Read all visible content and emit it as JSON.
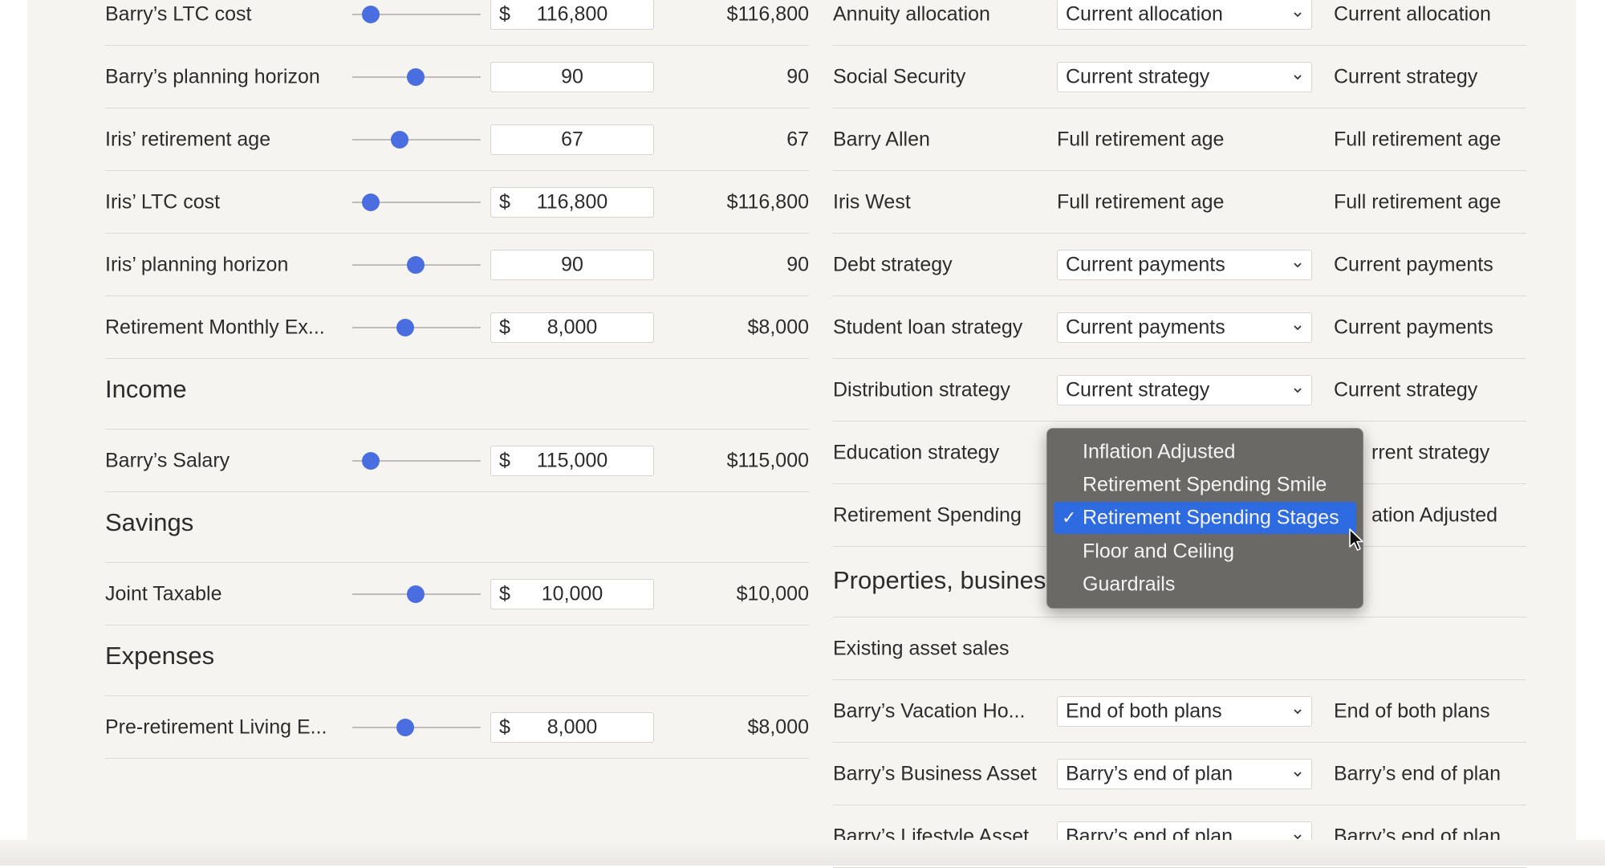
{
  "left": {
    "rows": [
      {
        "label": "Barry’s LTC cost",
        "currency": "$",
        "input": "116,800",
        "value": "$116,800"
      },
      {
        "label": "Barry’s planning horizon",
        "currency": "",
        "input": "90",
        "value": "90"
      },
      {
        "label": "Iris’ retirement age",
        "currency": "",
        "input": "67",
        "value": "67"
      },
      {
        "label": "Iris’ LTC cost",
        "currency": "$",
        "input": "116,800",
        "value": "$116,800"
      },
      {
        "label": "Iris’ planning horizon",
        "currency": "",
        "input": "90",
        "value": "90"
      },
      {
        "label": "Retirement Monthly Ex...",
        "currency": "$",
        "input": "8,000",
        "value": "$8,000"
      }
    ],
    "income": {
      "title": "Income",
      "rows": [
        {
          "label": "Barry’s Salary",
          "currency": "$",
          "input": "115,000",
          "value": "$115,000"
        }
      ]
    },
    "savings": {
      "title": "Savings",
      "rows": [
        {
          "label": "Joint Taxable",
          "currency": "$",
          "input": "10,000",
          "value": "$10,000"
        }
      ]
    },
    "expenses": {
      "title": "Expenses",
      "rows": [
        {
          "label": "Pre-retirement Living E...",
          "currency": "$",
          "input": "8,000",
          "value": "$8,000"
        }
      ]
    }
  },
  "right": {
    "rows": [
      {
        "label": "Annuity allocation",
        "select": "Current allocation",
        "value": "Current allocation"
      },
      {
        "label": "Social Security",
        "select": "Current strategy",
        "value": "Current strategy"
      },
      {
        "label": "Barry Allen",
        "plain": "Full retirement age",
        "value": "Full retirement age"
      },
      {
        "label": "Iris West",
        "plain": "Full retirement age",
        "value": "Full retirement age"
      },
      {
        "label": "Debt strategy",
        "select": "Current payments",
        "value": "Current payments"
      },
      {
        "label": "Student loan strategy",
        "select": "Current payments",
        "value": "Current payments"
      },
      {
        "label": "Distribution strategy",
        "select": "Current strategy",
        "value": "Current strategy"
      },
      {
        "label": "Education strategy",
        "value": "rrent strategy"
      },
      {
        "label": "Retirement Spending",
        "value": "ation Adjusted"
      }
    ],
    "properties": {
      "title": "Properties, busines",
      "rows": [
        {
          "label": "Existing asset sales"
        },
        {
          "label": "Barry’s Vacation Ho...",
          "select": "End of both plans",
          "value": "End of both plans"
        },
        {
          "label": "Barry’s Business Asset",
          "select": "Barry’s end of plan",
          "value": "Barry’s end of plan"
        },
        {
          "label": "Barry’s Lifestyle Asset",
          "select": "Barry’s end of plan",
          "value": "Barry’s end of plan"
        }
      ]
    }
  },
  "dropdown": {
    "options": [
      "Inflation Adjusted",
      "Retirement Spending Smile",
      "Retirement Spending Stages",
      "Floor and Ceiling",
      "Guardrails"
    ],
    "selected_index": 2,
    "check": "✓"
  },
  "colors": {
    "accent": "#4a6ee0",
    "selected": "#2f6be0",
    "menu": "#6b6966"
  }
}
